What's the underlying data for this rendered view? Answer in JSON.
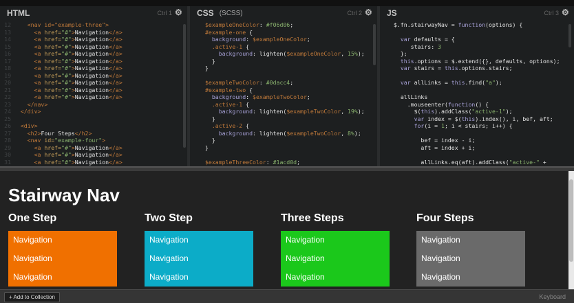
{
  "editors": {
    "html": {
      "title": "HTML",
      "subtitle": "",
      "shortcut": "Ctrl 1"
    },
    "css": {
      "title": "CSS",
      "subtitle": "(SCSS)",
      "shortcut": "Ctrl 2"
    },
    "js": {
      "title": "JS",
      "subtitle": "",
      "shortcut": "Ctrl 3"
    }
  },
  "result": {
    "page_title": "Stairway Nav",
    "columns": [
      {
        "heading": "One Step",
        "color": "#f07000",
        "items": [
          "Navigation",
          "Navigation",
          "Navigation"
        ]
      },
      {
        "heading": "Two Step",
        "color": "#0cacc8",
        "items": [
          "Navigation",
          "Navigation",
          "Navigation"
        ]
      },
      {
        "heading": "Three Steps",
        "color": "#1bc81b",
        "items": [
          "Navigation",
          "Navigation",
          "Navigation"
        ]
      },
      {
        "heading": "Four Steps",
        "color": "#6a6a6a",
        "items": [
          "Navigation",
          "Navigation",
          "Navigation"
        ]
      }
    ]
  },
  "footer": {
    "add_label": "+ Add to Collection",
    "keyboard_label": "Keyboard"
  }
}
